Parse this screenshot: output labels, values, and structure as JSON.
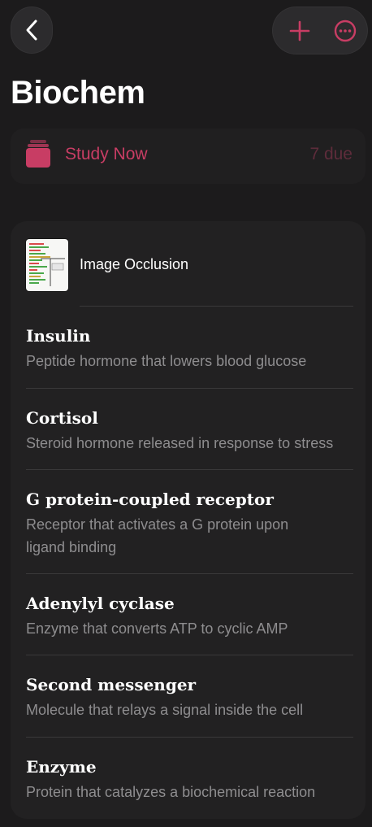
{
  "header": {
    "back_icon": "chevron-left-icon",
    "add_icon": "plus-icon",
    "more_icon": "ellipsis-circle-icon",
    "accent": "#c83d64"
  },
  "deck": {
    "title": "Biochem"
  },
  "study": {
    "label": "Study Now",
    "due": "7 due",
    "icon": "card-stack-icon",
    "color": "#c83d64"
  },
  "notes": {
    "image_occlusion": {
      "label": "Image Occlusion",
      "icon": "image-occlusion-thumbnail"
    },
    "items": [
      {
        "term": "Insulin",
        "definition": "Peptide hormone that lowers blood glucose"
      },
      {
        "term": "Cortisol",
        "definition": "Steroid hormone released in response to stress"
      },
      {
        "term": "G protein-coupled receptor",
        "definition": "Receptor that activates a G protein upon ligand binding"
      },
      {
        "term": "Adenylyl cyclase",
        "definition": "Enzyme that converts ATP to cyclic AMP"
      },
      {
        "term": "Second messenger",
        "definition": "Molecule that relays a signal inside the cell"
      },
      {
        "term": "Enzyme",
        "definition": "Protein that catalyzes a biochemical reaction"
      }
    ]
  }
}
